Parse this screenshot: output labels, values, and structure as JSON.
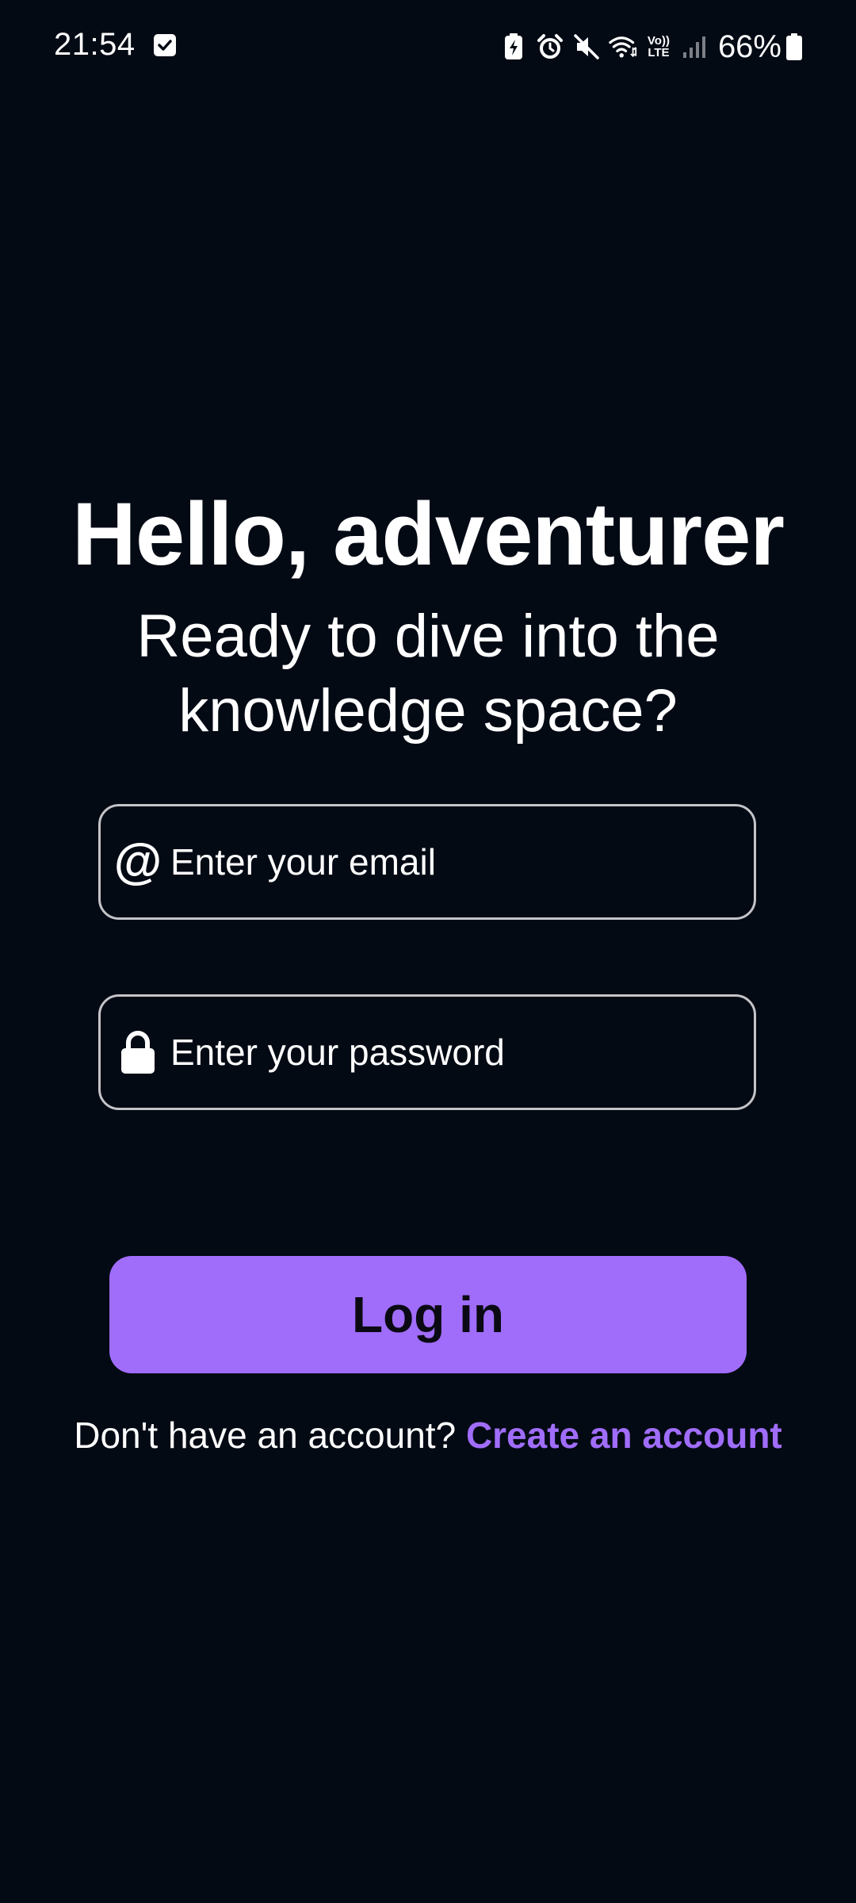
{
  "status_bar": {
    "time": "21:54",
    "volte_top": "Vo))",
    "volte_bottom": "LTE",
    "battery_percent": "66%",
    "icons": [
      "check-notification-icon",
      "battery-saver-icon",
      "alarm-icon",
      "mute-icon",
      "wifi-icon",
      "volte-icon",
      "signal-icon",
      "battery-icon"
    ]
  },
  "hero": {
    "title": "Hello, adventurer",
    "subtitle_line1": "Ready to dive into the",
    "subtitle_line2": "knowledge space?"
  },
  "form": {
    "email": {
      "icon": "at-icon",
      "at_symbol": "@",
      "value": "",
      "placeholder": "Enter your email"
    },
    "password": {
      "icon": "lock-icon",
      "value": "",
      "placeholder": "Enter your password"
    },
    "login_label": "Log in"
  },
  "signup": {
    "prompt": "Don't have an account?",
    "link_label": "Create an account"
  },
  "colors": {
    "background": "#040a14",
    "accent": "#a06dfb",
    "text": "#ffffff",
    "field_border": "#c4c4c8"
  }
}
